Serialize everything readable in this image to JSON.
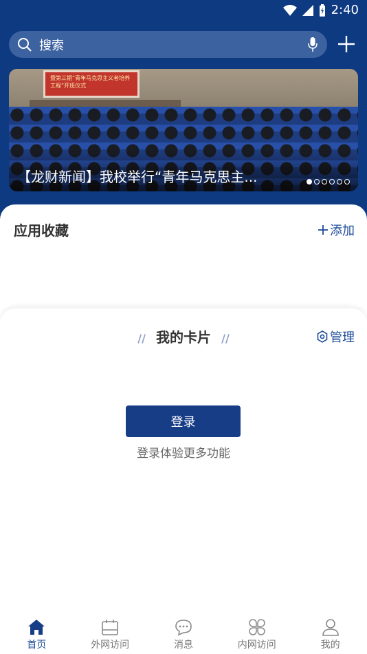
{
  "status_bar": {
    "time": "2:40"
  },
  "search": {
    "placeholder": "搜索"
  },
  "banner": {
    "caption": "【龙财新闻】我校举行“青年马克思主...",
    "screen_text": "暨第三期“青年马克思主义者培养工程”开班仪式",
    "slides": 6,
    "active_slide": 1
  },
  "favorites": {
    "title": "应用收藏",
    "add_label": "添加"
  },
  "card": {
    "title": "我的卡片",
    "manage_label": "管理",
    "login_label": "登录",
    "hint": "登录体验更多功能"
  },
  "tabbar": {
    "items": [
      {
        "label": "首页",
        "icon": "home-icon",
        "active": true
      },
      {
        "label": "外网访问",
        "icon": "calendar-icon",
        "active": false
      },
      {
        "label": "消息",
        "icon": "chat-icon",
        "active": false
      },
      {
        "label": "内网访问",
        "icon": "apps-icon",
        "active": false
      },
      {
        "label": "我的",
        "icon": "user-icon",
        "active": false
      }
    ]
  },
  "colors": {
    "brand": "#0d3a80",
    "accent": "#1d4c9a"
  }
}
